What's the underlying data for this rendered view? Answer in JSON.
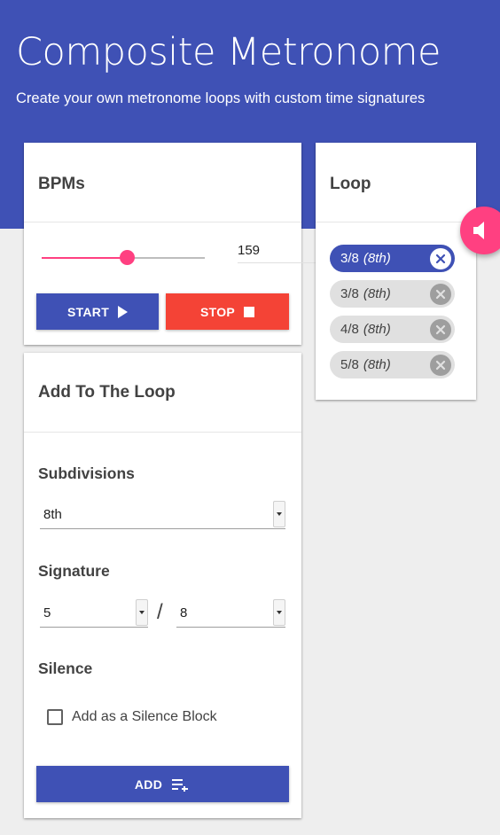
{
  "header": {
    "title": "Composite Metronome",
    "subtitle": "Create your own metronome loops with custom time signatures"
  },
  "bpm_card": {
    "title": "BPMs",
    "bpm_value": "159",
    "slider_fraction": 0.52,
    "start_label": "START",
    "stop_label": "STOP"
  },
  "loop_card": {
    "title": "Loop",
    "items": [
      {
        "signature": "3/8",
        "subdivision": "(8th)",
        "active": true
      },
      {
        "signature": "3/8",
        "subdivision": "(8th)",
        "active": false
      },
      {
        "signature": "4/8",
        "subdivision": "(8th)",
        "active": false
      },
      {
        "signature": "5/8",
        "subdivision": "(8th)",
        "active": false
      }
    ]
  },
  "add_card": {
    "title": "Add To The Loop",
    "subdivisions_label": "Subdivisions",
    "subdivisions_value": "8th",
    "signature_label": "Signature",
    "signature_top": "5",
    "signature_separator": "/",
    "signature_bottom": "8",
    "silence_label": "Silence",
    "silence_checkbox_label": "Add as a Silence Block",
    "silence_checked": false,
    "add_label": "ADD"
  },
  "colors": {
    "primary": "#3f51b5",
    "accent": "#ff4081",
    "danger": "#f44336",
    "background": "#eeeeee"
  },
  "icons": {
    "start": "play-icon",
    "stop": "stop-icon",
    "add": "playlist-add-icon",
    "chip_remove": "close-circle-icon",
    "fab": "volume-icon"
  }
}
